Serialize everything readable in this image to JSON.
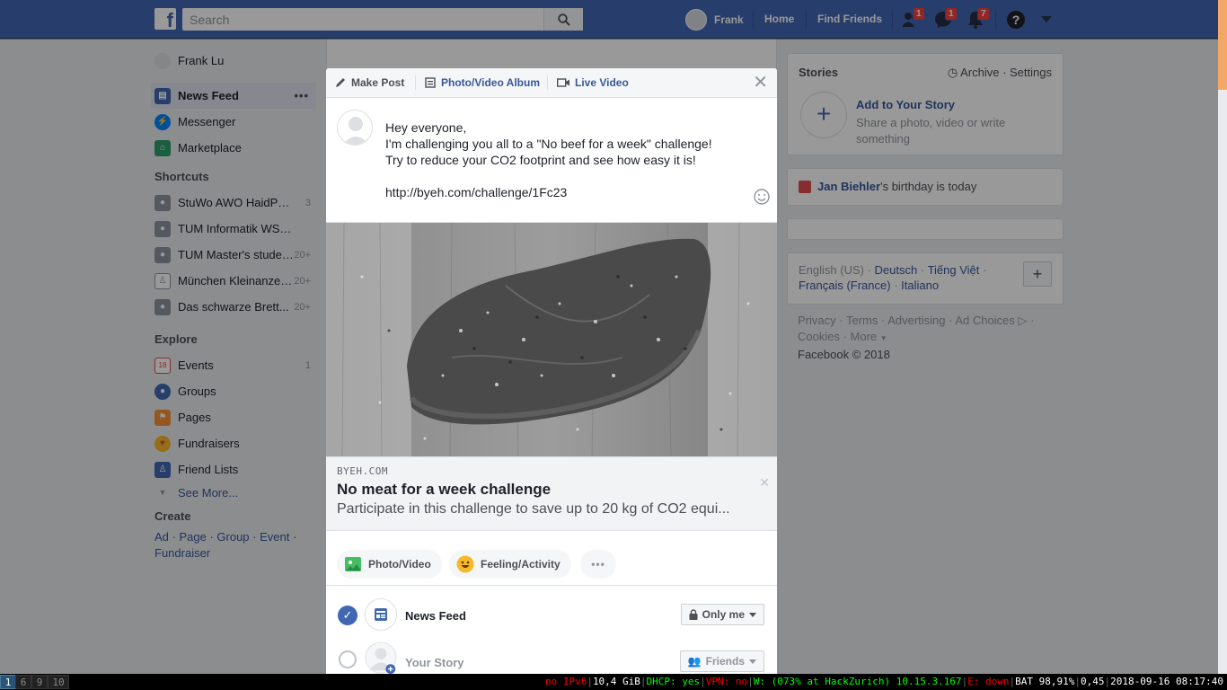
{
  "topbar": {
    "logo": "f",
    "search_placeholder": "Search",
    "user_name": "Frank",
    "home": "Home",
    "find_friends": "Find Friends",
    "friend_requests_count": "1",
    "messages_count": "1",
    "notifications_count": "7",
    "help": "?"
  },
  "left_nav": {
    "profile": "Frank Lu",
    "main": [
      {
        "label": "News Feed",
        "icon": "newsfeed-icon"
      },
      {
        "label": "Messenger",
        "icon": "messenger-icon"
      },
      {
        "label": "Marketplace",
        "icon": "marketplace-icon"
      }
    ],
    "more_dots": "•••",
    "shortcuts_title": "Shortcuts",
    "shortcuts": [
      {
        "label": "StuWo AWO HaidPark...",
        "count": "3"
      },
      {
        "label": "TUM Informatik WS 1...",
        "count": ""
      },
      {
        "label": "TUM Master's students...",
        "count": "20+"
      },
      {
        "label": "München Kleinanzeigen...",
        "count": "20+"
      },
      {
        "label": "Das schwarze Brett...",
        "count": "20+"
      }
    ],
    "explore_title": "Explore",
    "explore": [
      {
        "label": "Events",
        "count": "1",
        "icon": "calendar-icon",
        "icon_text": "18"
      },
      {
        "label": "Groups",
        "count": "",
        "icon": "groups-icon",
        "icon_text": ""
      },
      {
        "label": "Pages",
        "count": "",
        "icon": "flag-icon",
        "icon_text": ""
      },
      {
        "label": "Fundraisers",
        "count": "",
        "icon": "heart-icon",
        "icon_text": "♥"
      },
      {
        "label": "Friend Lists",
        "count": "",
        "icon": "friend-list-icon",
        "icon_text": ""
      }
    ],
    "see_more": "See More...",
    "create_title": "Create",
    "create_links": [
      "Ad",
      "Page",
      "Group",
      "Event",
      "Fundraiser"
    ]
  },
  "right_col": {
    "stories_title": "Stories",
    "archive": "Archive",
    "settings": "Settings",
    "add_story_title": "Add to Your Story",
    "add_story_sub": "Share a photo, video or write something",
    "birthday_name": "Jan Biehler",
    "birthday_text": "'s birthday is today",
    "languages": [
      "English (US)",
      "Deutsch",
      "Tiếng Việt",
      "Français (France)",
      "Italiano"
    ],
    "footer_links": [
      "Privacy",
      "Terms",
      "Advertising",
      "Ad Choices",
      "Cookies",
      "More"
    ],
    "copyright": "Facebook © 2018"
  },
  "composer": {
    "tabs": [
      "Make Post",
      "Photo/Video Album",
      "Live Video"
    ],
    "text": "Hey everyone,\nI'm challenging you all to a \"No beef for a week\" challenge!\nTry to reduce your CO2 footprint and see how easy it is!\n\nhttp://byeh.com/challenge/1Fc23",
    "preview": {
      "domain": "BYEH.COM",
      "title": "No meat for a week challenge",
      "description": "Participate in this challenge to save up to 20 kg of CO2 equi..."
    },
    "attachments": [
      "Photo/Video",
      "Feeling/Activity"
    ],
    "attach_more": "•••",
    "destinations": [
      {
        "label": "News Feed",
        "audience": "Only me",
        "checked": true
      },
      {
        "label": "Your Story",
        "audience": "Friends",
        "checked": false
      }
    ]
  },
  "statusbar": {
    "workspaces": [
      "1",
      "6",
      "9",
      "10"
    ],
    "ipv6": "no IPv6",
    "disk": "10,4 GiB",
    "dhcp": "DHCP: yes",
    "vpn": "VPN: no",
    "wifi": "W: (073% at HackZurich) 10.15.3.167",
    "eth": "E: down",
    "battery": "BAT 98,91%",
    "load": "0,45",
    "datetime": "2018-09-16 08:17:40"
  },
  "colors": {
    "brand": "#4267b2",
    "link": "#365899",
    "badge": "#fa3e3e"
  }
}
